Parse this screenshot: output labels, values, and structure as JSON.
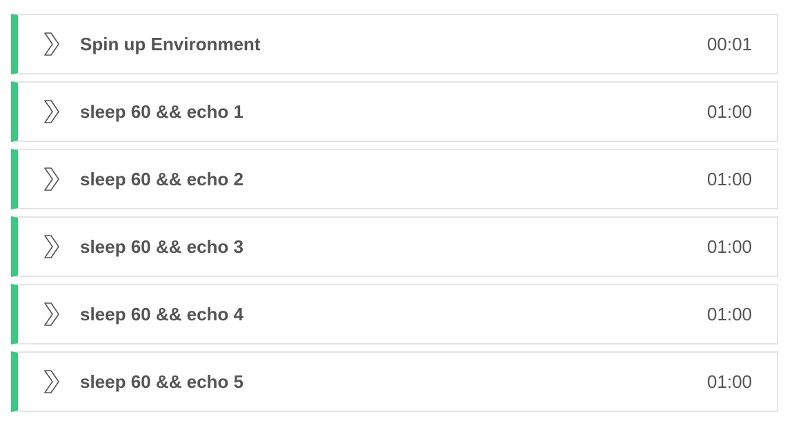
{
  "steps": [
    {
      "name": "Spin up Environment",
      "duration": "00:01",
      "status_color": "#3ec682",
      "icon": "chevron-right-icon"
    },
    {
      "name": "sleep 60 && echo 1",
      "duration": "01:00",
      "status_color": "#3ec682",
      "icon": "chevron-right-icon"
    },
    {
      "name": "sleep 60 && echo 2",
      "duration": "01:00",
      "status_color": "#3ec682",
      "icon": "chevron-right-icon"
    },
    {
      "name": "sleep 60 && echo 3",
      "duration": "01:00",
      "status_color": "#3ec682",
      "icon": "chevron-right-icon"
    },
    {
      "name": "sleep 60 && echo 4",
      "duration": "01:00",
      "status_color": "#3ec682",
      "icon": "chevron-right-icon"
    },
    {
      "name": "sleep 60 && echo 5",
      "duration": "01:00",
      "status_color": "#3ec682",
      "icon": "chevron-right-icon"
    }
  ]
}
